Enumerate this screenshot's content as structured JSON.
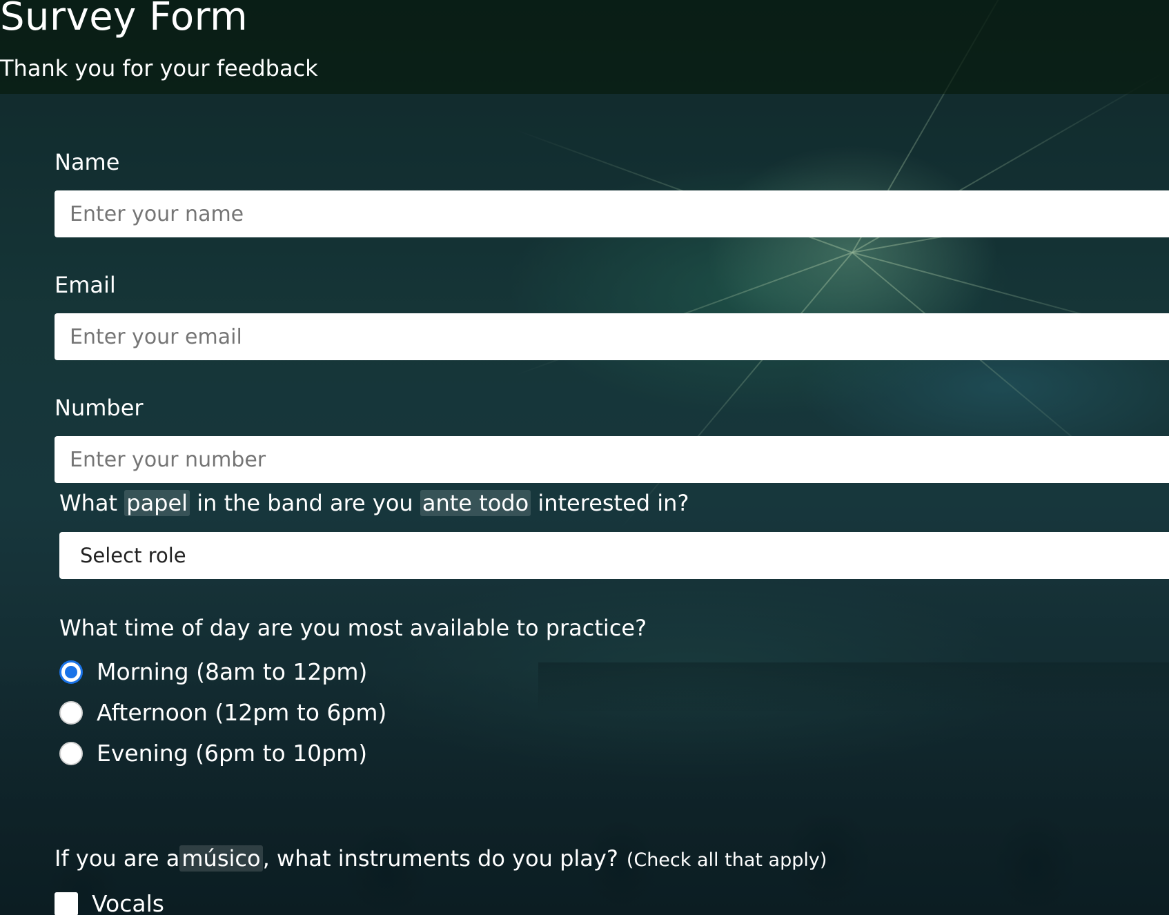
{
  "header": {
    "title": "Survey Form",
    "subtitle": "Thank you for your feedback"
  },
  "form": {
    "name": {
      "label": "Name",
      "placeholder": "Enter your name"
    },
    "email": {
      "label": "Email",
      "placeholder": "Enter your email"
    },
    "number": {
      "label": "Number",
      "placeholder": "Enter your number"
    },
    "role": {
      "question_parts": [
        "What ",
        "papel",
        " in the band are you ",
        "ante todo",
        " interested in?"
      ],
      "selected": "Select role"
    },
    "availability": {
      "question": "What time of day are you most available to practice?",
      "options": [
        {
          "label": "Morning (8am to 12pm)",
          "checked": true
        },
        {
          "label": "Afternoon (12pm to 6pm)",
          "checked": false
        },
        {
          "label": "Evening (6pm to 10pm)",
          "checked": false
        }
      ]
    },
    "instruments": {
      "question_parts": [
        "If you are a ",
        "músico",
        ", what instruments do you play?"
      ],
      "note": "(Check all that apply)",
      "options": [
        {
          "label": "Vocals",
          "checked": false
        }
      ]
    }
  },
  "colors": {
    "radio_accent": "#1a73e8",
    "input_background": "#ffffff",
    "text": "#ffffff"
  }
}
